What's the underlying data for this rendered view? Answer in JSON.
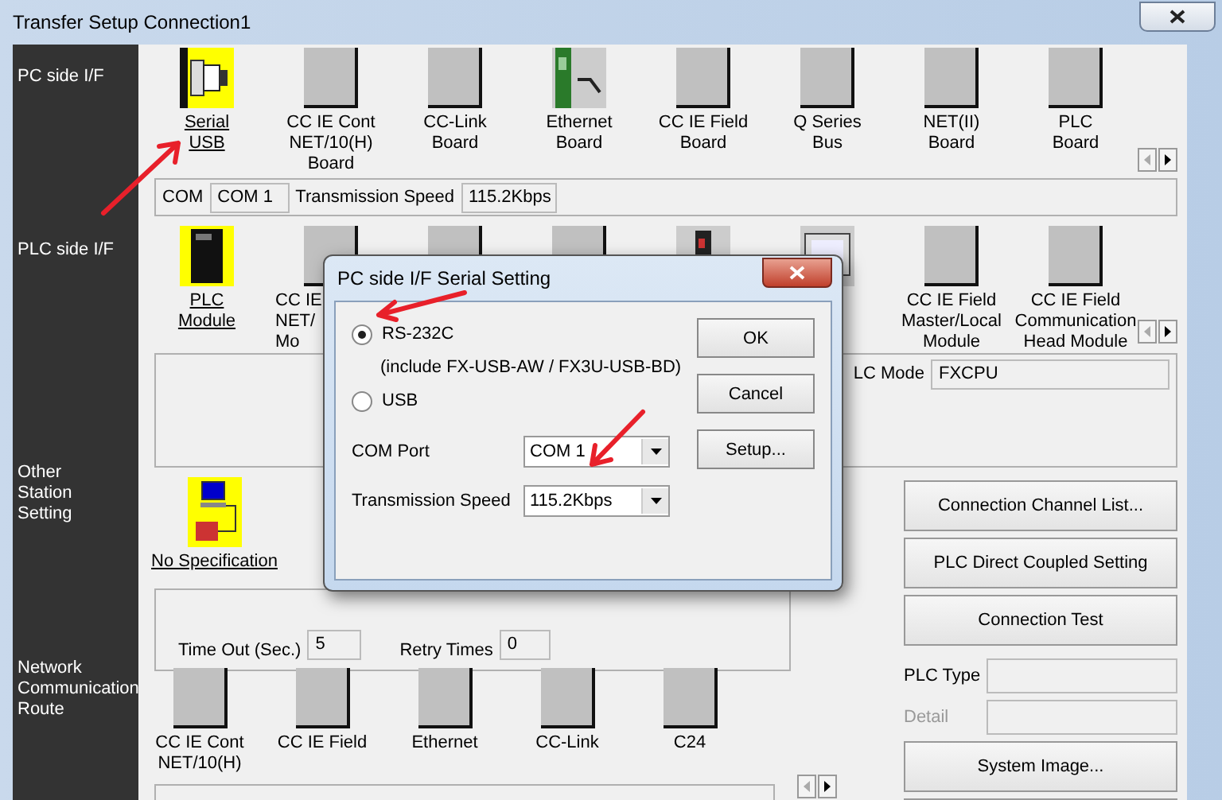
{
  "window": {
    "title": "Transfer Setup Connection1"
  },
  "pc_side": {
    "label": "PC side I/F",
    "items": [
      {
        "kind": "serial",
        "lines": [
          "Serial",
          "USB"
        ],
        "selected": true
      },
      {
        "kind": "board",
        "lines": [
          "CC IE Cont",
          "NET/10(H)",
          "Board"
        ],
        "selected": false
      },
      {
        "kind": "board",
        "lines": [
          "CC-Link",
          "Board"
        ],
        "selected": false
      },
      {
        "kind": "ethernet",
        "lines": [
          "Ethernet",
          "Board"
        ],
        "selected": false
      },
      {
        "kind": "board",
        "lines": [
          "CC IE Field",
          "Board"
        ],
        "selected": false
      },
      {
        "kind": "board",
        "lines": [
          "Q Series",
          "Bus"
        ],
        "selected": false
      },
      {
        "kind": "board",
        "lines": [
          "NET(II)",
          "Board"
        ],
        "selected": false
      },
      {
        "kind": "board",
        "lines": [
          "PLC",
          "Board"
        ],
        "selected": false
      }
    ]
  },
  "com_row": {
    "com_label": "COM",
    "com_value": "COM 1",
    "speed_label": "Transmission Speed",
    "speed_value": "115.2Kbps"
  },
  "plc_side": {
    "label": "PLC side I/F",
    "items": [
      {
        "kind": "plc",
        "lines": [
          "PLC",
          "Module"
        ],
        "selected": true
      },
      {
        "kind": "board",
        "lines": [
          "CC IE",
          "NET/",
          "Mo"
        ],
        "covered": true,
        "selected": false
      },
      {
        "kind": "board"
      },
      {
        "kind": "board"
      },
      {
        "kind": "device"
      },
      {
        "kind": "panel"
      },
      {
        "kind": "board",
        "lines": [
          "CC IE Field",
          "Master/Local",
          "Module"
        ],
        "selected": false
      },
      {
        "kind": "board",
        "lines": [
          "CC IE Field",
          "Communication",
          "Head Module"
        ],
        "selected": false
      }
    ],
    "mode_label": "LC Mode",
    "mode_value": "FXCPU"
  },
  "other_station": {
    "lines": [
      "Other",
      "Station",
      "Setting"
    ],
    "item": {
      "kind": "station",
      "label": "No Specification",
      "selected": true
    },
    "timeout_label": "Time Out (Sec.)",
    "timeout_value": "5",
    "retry_label": "Retry Times",
    "retry_value": "0"
  },
  "network_route": {
    "lines": [
      "Network",
      "Communication",
      "Route"
    ],
    "items": [
      {
        "kind": "board",
        "lines": [
          "CC IE Cont",
          "NET/10(H)"
        ],
        "selected": false
      },
      {
        "kind": "board",
        "lines": [
          "CC IE Field"
        ],
        "selected": false
      },
      {
        "kind": "board",
        "lines": [
          "Ethernet"
        ],
        "selected": false
      },
      {
        "kind": "board",
        "lines": [
          "CC-Link"
        ],
        "selected": false
      },
      {
        "kind": "board",
        "lines": [
          "C24"
        ],
        "selected": false
      }
    ]
  },
  "side_buttons": [
    "Connection Channel List...",
    "PLC Direct Coupled Setting",
    "Connection Test"
  ],
  "plc_type": {
    "label": "PLC Type",
    "disabled": false
  },
  "detail": {
    "label": "Detail",
    "disabled": true
  },
  "system_image_button": "System Image...",
  "dialog": {
    "title": "PC side I/F Serial Setting",
    "options": [
      {
        "label": "RS-232C",
        "note": "(include FX-USB-AW / FX3U-USB-BD)",
        "selected": true
      },
      {
        "label": "USB",
        "selected": false
      }
    ],
    "com_port_label": "COM Port",
    "com_port_value": "COM 1",
    "speed_label": "Transmission Speed",
    "speed_value": "115.2Kbps",
    "buttons": [
      "OK",
      "Cancel",
      "Setup..."
    ]
  }
}
